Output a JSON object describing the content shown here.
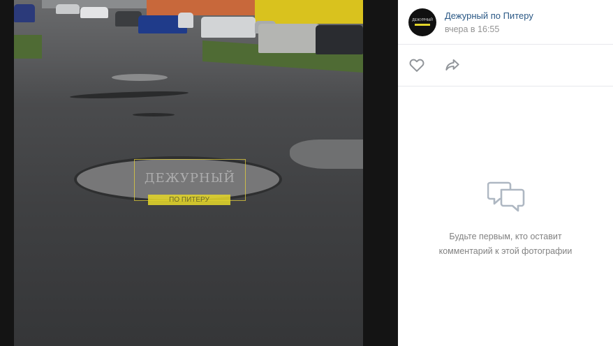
{
  "post": {
    "author": "Дежурный по Питеру",
    "date": "вчера в 16:55",
    "avatar_label": "ДЕЖУРНЫЙ"
  },
  "photo": {
    "watermark_title": "ДЕЖУРНЫЙ",
    "watermark_subtitle": "ПО ПИТЕРУ"
  },
  "actions": {
    "like_icon": "heart-icon",
    "share_icon": "share-arrow-icon"
  },
  "comments": {
    "empty_line1": "Будьте первым, кто оставит",
    "empty_line2": "комментарий к этой фотографии",
    "icon": "comment-bubbles-icon"
  },
  "colors": {
    "link": "#2a5885",
    "muted": "#939393",
    "brand_yellow": "#e2d52a",
    "viewer_bg": "#141414"
  }
}
